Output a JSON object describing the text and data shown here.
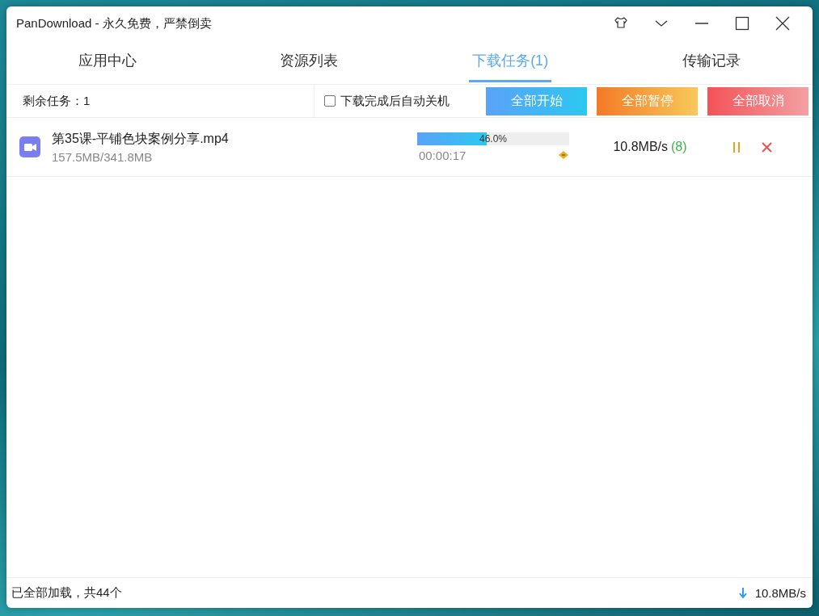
{
  "window": {
    "title": "PanDownload - 永久免费，严禁倒卖"
  },
  "tabs": [
    {
      "label": "应用中心",
      "selected": false
    },
    {
      "label": "资源列表",
      "selected": false
    },
    {
      "label": "下载任务(1)",
      "selected": true
    },
    {
      "label": "传输记录",
      "selected": false
    }
  ],
  "toolbar": {
    "remaining": "剩余任务：1",
    "auto_shutdown": {
      "label": "下载完成后自动关机",
      "checked": false
    },
    "buttons": [
      {
        "label": "全部开始",
        "kind": "start"
      },
      {
        "label": "全部暂停",
        "kind": "pause"
      },
      {
        "label": "全部取消",
        "kind": "cancel"
      }
    ]
  },
  "tasks": [
    {
      "name": "第35课-平铺色块案例分享.mp4",
      "size": "157.5MB/341.8MB",
      "level": 0.46,
      "percent": "46.0%",
      "elapsed": "00:00:17",
      "speed": "10.8MB/s",
      "threads": "(8)"
    }
  ],
  "status_bar": {
    "text": "已全部加载，共44个",
    "speed": "10.8MB/s"
  }
}
